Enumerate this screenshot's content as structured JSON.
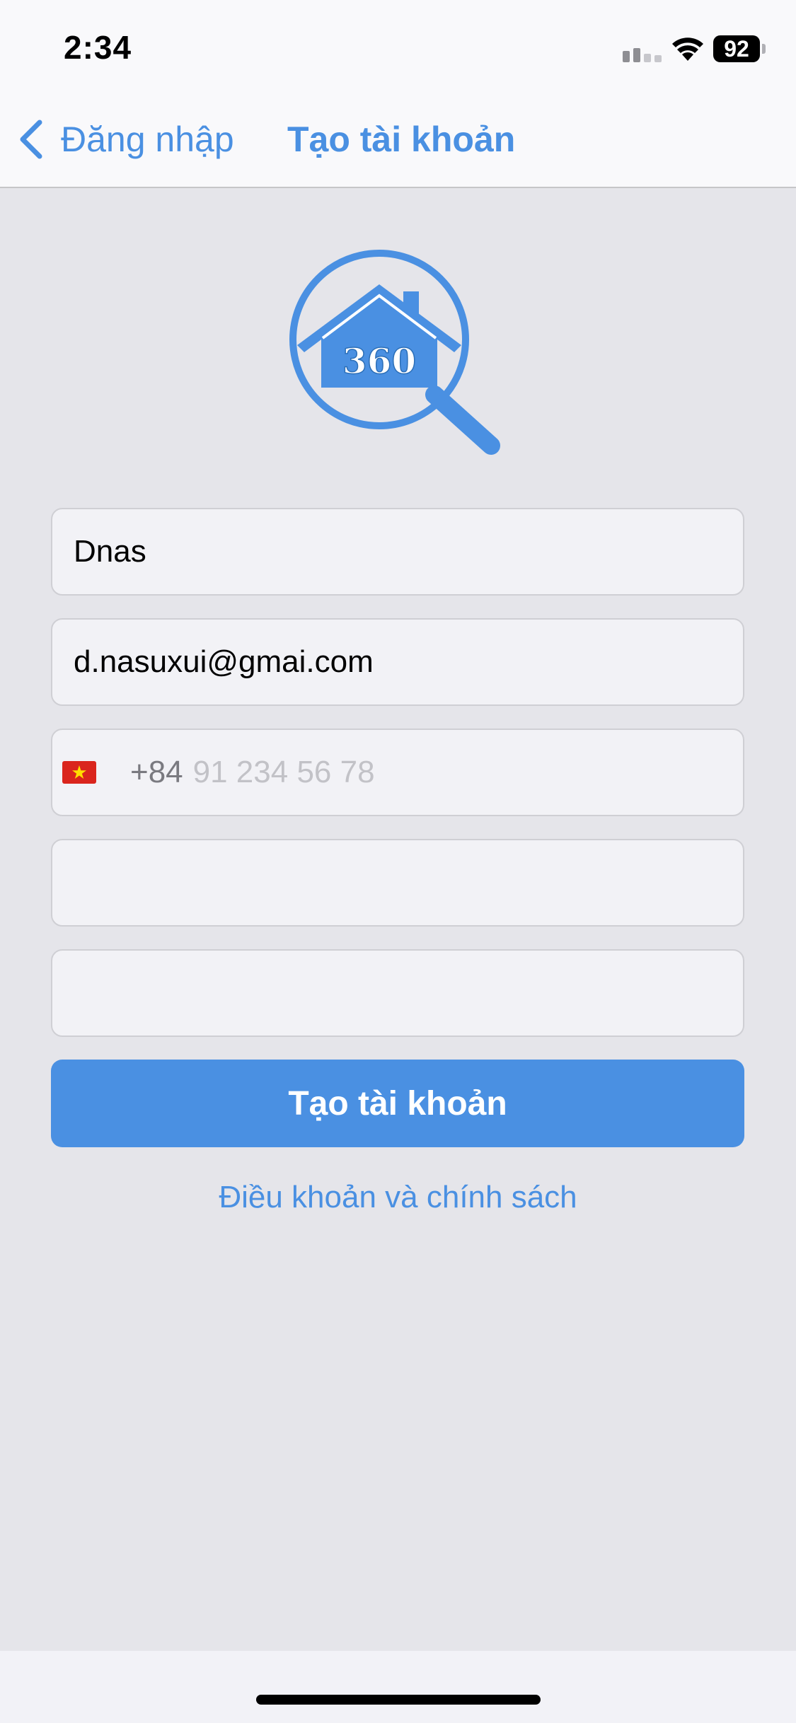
{
  "status_bar": {
    "time": "2:34",
    "battery_level": "92",
    "icons": [
      "signal-icon",
      "wifi-icon",
      "battery-icon"
    ]
  },
  "nav": {
    "back_label": "Đăng nhập",
    "title": "Tạo tài khoản",
    "back_icon": "chevron-left-icon"
  },
  "logo": {
    "text": "360",
    "icon": "house-magnifier-logo"
  },
  "form": {
    "name_value": "Dnas",
    "email_value": "d.nasuxui@gmai.com",
    "phone": {
      "country_flag": "vietnam-flag-icon",
      "dial_code": "+84",
      "placeholder": "91 234 56 78"
    },
    "password_value": "",
    "confirm_password_value": ""
  },
  "actions": {
    "create_button_label": "Tạo tài khoản",
    "terms_link_label": "Điều khoản và chính sách"
  },
  "colors": {
    "accent": "#4a90e2",
    "background": "#e5e5ea",
    "field_background": "#f2f2f6"
  }
}
